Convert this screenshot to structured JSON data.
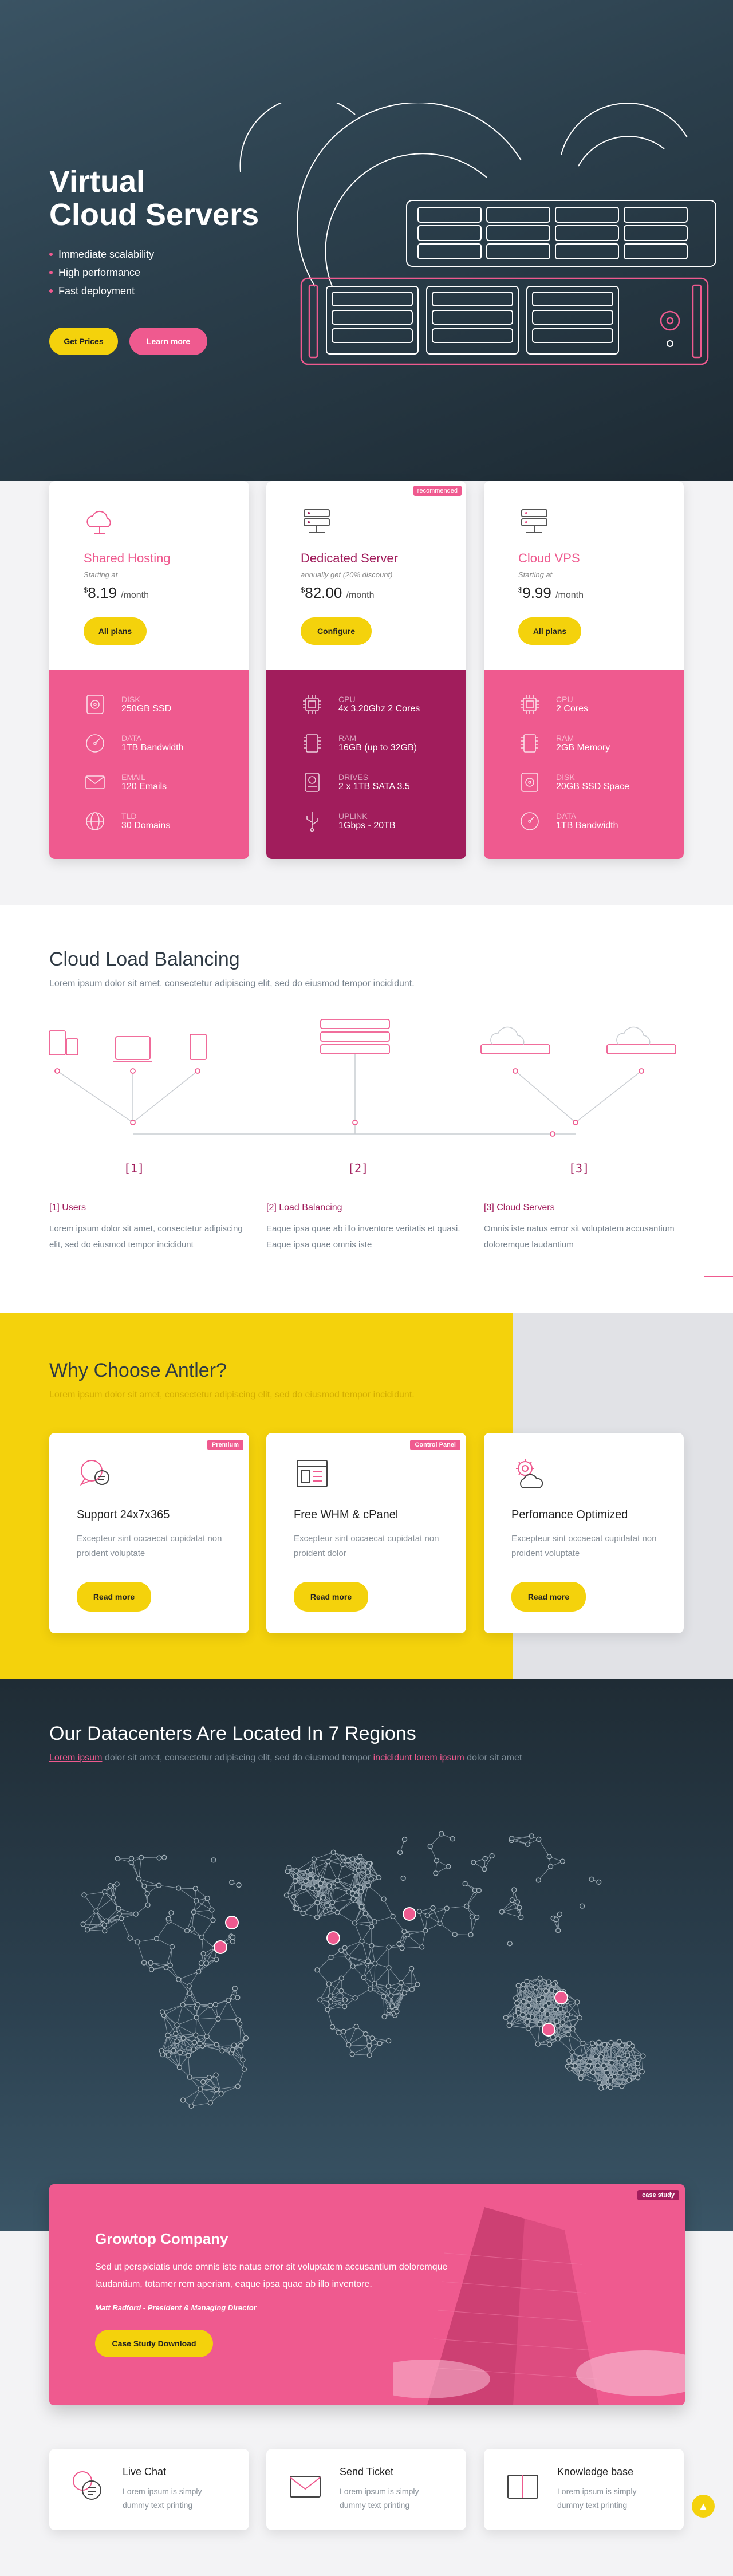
{
  "hero": {
    "title_line1": "Virtual",
    "title_line2": "Cloud Servers",
    "bullets": [
      "Immediate scalability",
      "High performance",
      "Fast deployment"
    ],
    "get_prices": "Get Prices",
    "learn_more": "Learn more"
  },
  "pricing": [
    {
      "name": "Shared Hosting",
      "sub": "Starting at",
      "cur": "$",
      "price": "8.19",
      "per": "/month",
      "button": "All plans",
      "badge": "",
      "specs": [
        {
          "label": "Disk",
          "value": "250GB SSD",
          "icon": "disk-icon"
        },
        {
          "label": "Data",
          "value": "1TB Bandwidth",
          "icon": "gauge-icon"
        },
        {
          "label": "Email",
          "value": "120 Emails",
          "icon": "envelope-icon"
        },
        {
          "label": "Tld",
          "value": "30 Domains",
          "icon": "globe-icon"
        }
      ]
    },
    {
      "name": "Dedicated Server",
      "sub": "annually get (20% discount)",
      "cur": "$",
      "price": "82.00",
      "per": "/month",
      "button": "Configure",
      "badge": "recommended",
      "specs": [
        {
          "label": "CPU",
          "value": "4x 3.20Ghz 2 Cores",
          "icon": "cpu-icon"
        },
        {
          "label": "RAM",
          "value": "16GB (up to 32GB)",
          "icon": "ram-icon"
        },
        {
          "label": "Drives",
          "value": "2 x 1TB SATA 3.5",
          "icon": "drive-icon"
        },
        {
          "label": "Uplink",
          "value": "1Gbps - 20TB",
          "icon": "usb-icon"
        }
      ]
    },
    {
      "name": "Cloud VPS",
      "sub": "Starting at",
      "cur": "$",
      "price": "9.99",
      "per": "/month",
      "button": "All plans",
      "badge": "",
      "specs": [
        {
          "label": "CPU",
          "value": "2 Cores",
          "icon": "cpu-icon"
        },
        {
          "label": "RAM",
          "value": "2GB Memory",
          "icon": "ram-icon"
        },
        {
          "label": "Disk",
          "value": "20GB SSD Space",
          "icon": "disk-icon"
        },
        {
          "label": "Data",
          "value": "1TB Bandwidth",
          "icon": "gauge-icon"
        }
      ]
    }
  ],
  "lb": {
    "title": "Cloud Load Balancing",
    "sub": "Lorem ipsum dolor sit amet, consectetur adipiscing elit, sed do eiusmod tempor incididunt.",
    "markers": [
      "[1]",
      "[2]",
      "[3]"
    ],
    "cols": [
      {
        "head": "[1] Users",
        "text": "Lorem ipsum dolor sit amet, consectetur adipiscing elit, sed do eiusmod tempor incididunt"
      },
      {
        "head": "[2] Load Balancing",
        "text": "Eaque ipsa quae ab illo inventore veritatis et quasi. Eaque ipsa quae omnis iste"
      },
      {
        "head": "[3] Cloud Servers",
        "text": "Omnis iste natus error sit voluptatem accusantium doloremque laudantium"
      }
    ]
  },
  "why": {
    "title": "Why Choose Antler?",
    "sub": "Lorem ipsum dolor sit amet, consectetur adipiscing elit, sed do eiusmod tempor incididunt.",
    "cards": [
      {
        "name": "Support 24x7x365",
        "desc": "Excepteur sint occaecat cupidatat non proident voluptate",
        "button": "Read more",
        "badge": "Premium",
        "icon": "chat-support-icon"
      },
      {
        "name": "Free WHM & cPanel",
        "desc": "Excepteur sint occaecat cupidatat non proident dolor",
        "button": "Read more",
        "badge": "Control Panel",
        "icon": "control-panel-icon"
      },
      {
        "name": "Perfomance Optimized",
        "desc": "Excepteur sint occaecat cupidatat non proident voluptate",
        "button": "Read more",
        "badge": "",
        "icon": "gear-cloud-icon"
      }
    ]
  },
  "dc": {
    "title": "Our Datacenters Are Located In 7 Regions",
    "sub_a": "Lorem ipsum",
    "sub_b": " dolor sit amet, consectetur adipiscing elit, sed do eiusmod tempor ",
    "sub_c": "incididunt lorem ipsum",
    "sub_d": " dolor sit amet"
  },
  "case": {
    "badge": "case study",
    "title": "Growtop Company",
    "text": "Sed ut perspiciatis unde omnis iste natus error sit voluptatem accusantium doloremque laudantium, totamer rem aperiam, eaque ipsa quae ab illo inventore.",
    "author": "Matt Radford - President & Managing Director",
    "button": "Case Study Download"
  },
  "contact": [
    {
      "name": "Live Chat",
      "desc": "Lorem ipsum is simply dummy text printing",
      "icon": "chat-icon"
    },
    {
      "name": "Send Ticket",
      "desc": "Lorem ipsum is simply dummy text printing",
      "icon": "envelope-icon"
    },
    {
      "name": "Knowledge base",
      "desc": "Lorem ipsum is simply dummy text printing",
      "icon": "book-icon"
    }
  ],
  "colors": {
    "pink": "#ef5a8f",
    "magenta": "#a11d5c",
    "yellow": "#f4d20c",
    "navy": "#2b3f4c"
  }
}
